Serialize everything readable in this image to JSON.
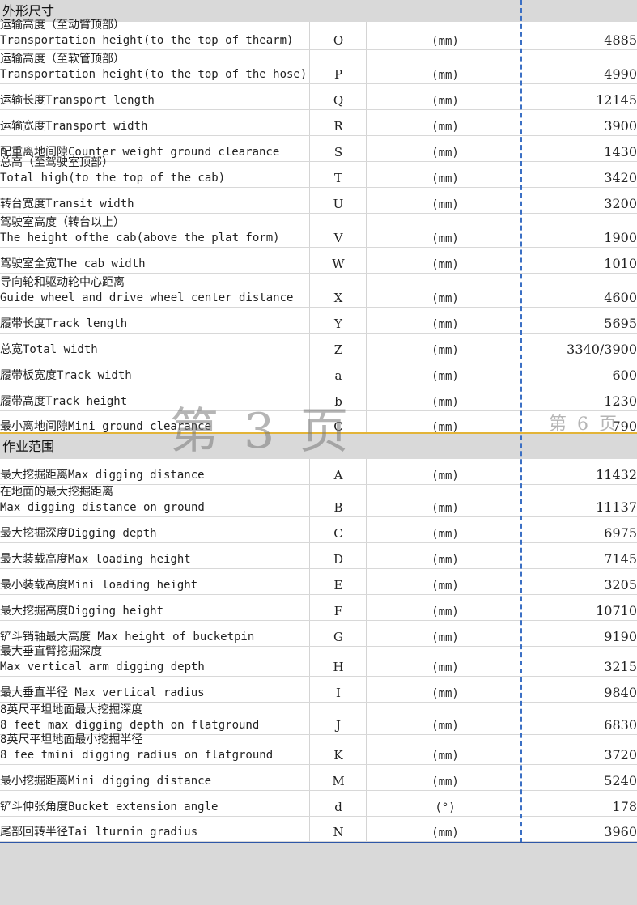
{
  "sections": [
    {
      "title": "外形尺寸",
      "rows": [
        {
          "desc": [
            "运输高度（至动臂顶部）",
            "Transportation height(to the top of thearm)"
          ],
          "code": "O",
          "unit": "(mm)",
          "value": "4885"
        },
        {
          "desc": [
            "运输高度（至软管顶部）",
            "Transportation height(to the top of the hose)"
          ],
          "code": "P",
          "unit": "(mm)",
          "value": "4990"
        },
        {
          "desc": [
            "运输长度Transport length"
          ],
          "code": "Q",
          "unit": "(mm)",
          "value": "12145"
        },
        {
          "desc": [
            "运输宽度Transport width"
          ],
          "code": "R",
          "unit": "(mm)",
          "value": "3900"
        },
        {
          "desc": [
            "配重离地间隙Counter weight ground clearance"
          ],
          "code": "S",
          "unit": "(mm)",
          "value": "1430"
        },
        {
          "desc": [
            "总高（至驾驶室顶部）",
            "Total high(to the top of the cab)"
          ],
          "code": "T",
          "unit": "(mm)",
          "value": "3420"
        },
        {
          "desc": [
            "转台宽度Transit width"
          ],
          "code": "U",
          "unit": "(mm)",
          "value": "3200"
        },
        {
          "desc": [
            "驾驶室高度（转台以上）",
            "The height ofthe cab(above the plat form)"
          ],
          "code": "V",
          "unit": "(mm)",
          "value": "1900"
        },
        {
          "desc": [
            "驾驶室全宽The cab width"
          ],
          "code": "W",
          "unit": "(mm)",
          "value": "1010"
        },
        {
          "desc": [
            "导向轮和驱动轮中心距离",
            "Guide wheel and drive wheel center distance"
          ],
          "code": "X",
          "unit": "(mm)",
          "value": "4600"
        },
        {
          "desc": [
            "履带长度Track length"
          ],
          "code": "Y",
          "unit": "(mm)",
          "value": "5695"
        },
        {
          "desc": [
            "总宽Total width"
          ],
          "code": "Z",
          "unit": "(mm)",
          "value": "3340/3900"
        },
        {
          "desc": [
            "履带板宽度Track width"
          ],
          "code": "a",
          "unit": "(mm)",
          "value": "600"
        },
        {
          "desc": [
            "履带高度Track height"
          ],
          "code": "b",
          "unit": "(mm)",
          "value": "1230"
        },
        {
          "desc": [
            "最小离地间隙Mini ground clearance"
          ],
          "code": "C",
          "unit": "(mm)",
          "value": "790"
        }
      ]
    },
    {
      "title": "作业范围",
      "rows": [
        {
          "desc": [
            "最大挖掘距离Max digging distance"
          ],
          "code": "A",
          "unit": "(mm)",
          "value": "11432"
        },
        {
          "desc": [
            "在地面的最大挖掘距离",
            "Max digging distance on ground"
          ],
          "code": "B",
          "unit": "(mm)",
          "value": "11137"
        },
        {
          "desc": [
            "最大挖掘深度Digging depth"
          ],
          "code": "C",
          "unit": "(mm)",
          "value": "6975"
        },
        {
          "desc": [
            "最大装载高度Max loading height"
          ],
          "code": "D",
          "unit": "(mm)",
          "value": "7145"
        },
        {
          "desc": [
            "最小装载高度Mini loading height"
          ],
          "code": "E",
          "unit": "(mm)",
          "value": "3205"
        },
        {
          "desc": [
            "最大挖掘高度Digging height"
          ],
          "code": "F",
          "unit": "(mm)",
          "value": "10710"
        },
        {
          "desc": [
            "铲斗销轴最大高度 Max height of bucketpin"
          ],
          "code": "G",
          "unit": "(mm)",
          "value": "9190"
        },
        {
          "desc": [
            "最大垂直臂挖掘深度",
            "Max vertical arm digging depth"
          ],
          "code": "H",
          "unit": "(mm)",
          "value": "3215"
        },
        {
          "desc": [
            "最大垂直半径 Max vertical radius"
          ],
          "code": "I",
          "unit": "(mm)",
          "value": "9840"
        },
        {
          "desc": [
            "8英尺平坦地面最大挖掘深度",
            "8 feet max digging depth on flatground"
          ],
          "code": "J",
          "unit": "(mm)",
          "value": "6830"
        },
        {
          "desc": [
            "8英尺平坦地面最小挖掘半径",
            "8 fee tmini digging radius on flatground"
          ],
          "code": "K",
          "unit": "(mm)",
          "value": "3720"
        },
        {
          "desc": [
            "最小挖掘距离Mini digging distance"
          ],
          "code": "M",
          "unit": "(mm)",
          "value": "5240"
        },
        {
          "desc": [
            "铲斗伸张角度Bucket extension angle"
          ],
          "code": "d",
          "unit": "(°)",
          "value": "178"
        },
        {
          "desc": [
            "尾部回转半径Tai lturnin gradius"
          ],
          "code": "N",
          "unit": "(mm)",
          "value": "3960"
        }
      ]
    }
  ],
  "watermarks": {
    "page_big": "第 3 页",
    "page_small": "第 6 页"
  },
  "colors": {
    "page_break_line": "#e3b437",
    "page_boundary_dash": "#3a6fc4",
    "section_header_bg": "#d9d9d9"
  }
}
